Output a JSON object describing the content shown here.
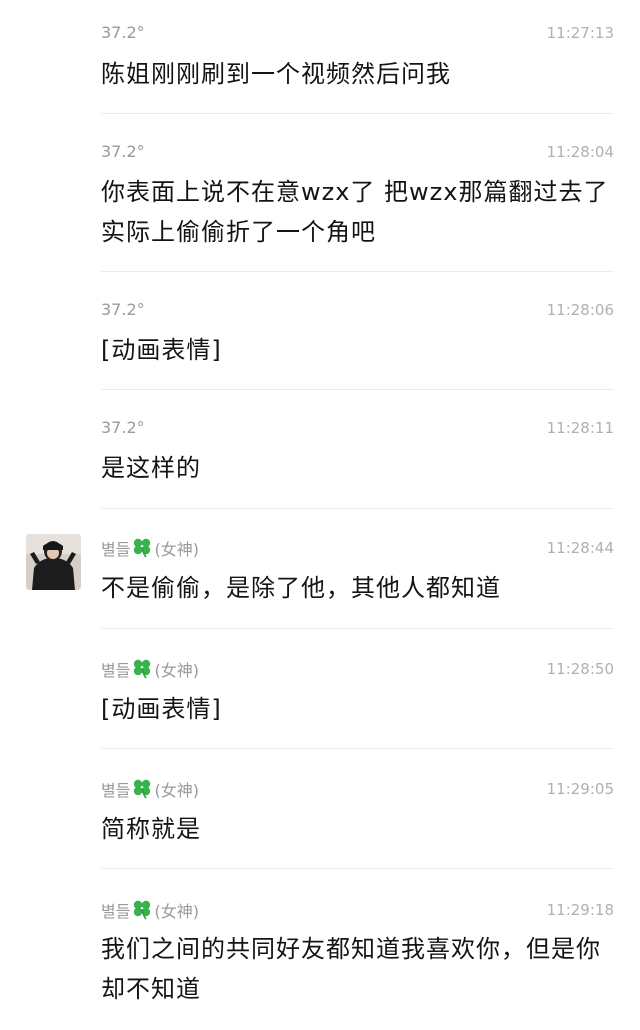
{
  "messages": [
    {
      "sender": "37.2°",
      "time": "11:27:13",
      "text": "陈姐刚刚刷到一个视频然后问我"
    },
    {
      "sender": "37.2°",
      "time": "11:28:04",
      "text": "你表面上说不在意wzx了 把wzx那篇翻过去了 实际上偷偷折了一个角吧"
    },
    {
      "sender": "37.2°",
      "time": "11:28:06",
      "text": "[动画表情]"
    },
    {
      "sender": "37.2°",
      "time": "11:28:11",
      "text": "是这样的"
    },
    {
      "sender_name": "별들",
      "sender_tag": "(女神)",
      "time": "11:28:44",
      "text": "不是偷偷，是除了他，其他人都知道"
    },
    {
      "sender_name": "별들",
      "sender_tag": "(女神)",
      "time": "11:28:50",
      "text": "[动画表情]"
    },
    {
      "sender_name": "별들",
      "sender_tag": "(女神)",
      "time": "11:29:05",
      "text": "简称就是"
    },
    {
      "sender_name": "별들",
      "sender_tag": "(女神)",
      "time": "11:29:18",
      "text": "我们之间的共同好友都知道我喜欢你，但是你却不知道"
    }
  ],
  "icons": {
    "clover": "four-leaf-clover-icon",
    "avatar": "user-avatar"
  },
  "colors": {
    "clover": "#37b24d",
    "meta_text": "#9a9a9a",
    "time_text": "#b0b0b0",
    "message_text": "#141414",
    "divider": "#ececec"
  }
}
